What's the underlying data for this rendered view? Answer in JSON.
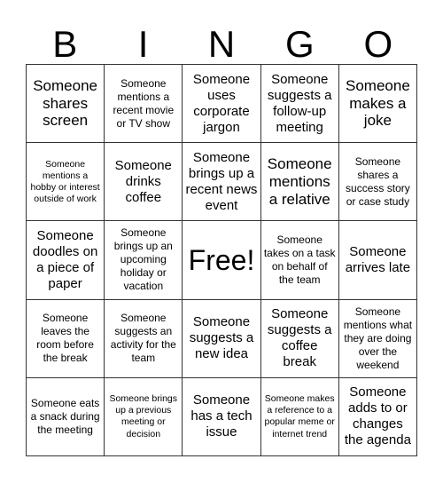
{
  "card": {
    "header": [
      "B",
      "I",
      "N",
      "G",
      "O"
    ],
    "free_label": "Free!",
    "cells": [
      [
        {
          "text": "Someone shares screen",
          "size": "l"
        },
        {
          "text": "Someone mentions a recent movie or TV show",
          "size": "s"
        },
        {
          "text": "Someone uses corporate jargon",
          "size": "m"
        },
        {
          "text": "Someone suggests a follow-up meeting",
          "size": "m"
        },
        {
          "text": "Someone makes a joke",
          "size": "l"
        }
      ],
      [
        {
          "text": "Someone mentions a hobby or interest outside of work",
          "size": "xs"
        },
        {
          "text": "Someone drinks coffee",
          "size": "m"
        },
        {
          "text": "Someone brings up a recent news event",
          "size": "m"
        },
        {
          "text": "Someone mentions a relative",
          "size": "l"
        },
        {
          "text": "Someone shares a success story or case study",
          "size": "s"
        }
      ],
      [
        {
          "text": "Someone doodles on a piece of paper",
          "size": "m"
        },
        {
          "text": "Someone brings up an upcoming holiday or vacation",
          "size": "s"
        },
        {
          "text": "Free!",
          "size": "free"
        },
        {
          "text": "Someone takes on a task on behalf of the team",
          "size": "s"
        },
        {
          "text": "Someone arrives late",
          "size": "m"
        }
      ],
      [
        {
          "text": "Someone leaves the room before the break",
          "size": "s"
        },
        {
          "text": "Someone suggests an activity for the team",
          "size": "s"
        },
        {
          "text": "Someone suggests a new idea",
          "size": "m"
        },
        {
          "text": "Someone suggests a coffee break",
          "size": "m"
        },
        {
          "text": "Someone mentions what they are doing over the weekend",
          "size": "s"
        }
      ],
      [
        {
          "text": "Someone eats a snack during the meeting",
          "size": "s"
        },
        {
          "text": "Someone brings up a previous meeting or decision",
          "size": "xs"
        },
        {
          "text": "Someone has a tech issue",
          "size": "m"
        },
        {
          "text": "Someone makes a reference to a popular meme or internet trend",
          "size": "xs"
        },
        {
          "text": "Someone adds to or changes the agenda",
          "size": "m"
        }
      ]
    ]
  }
}
